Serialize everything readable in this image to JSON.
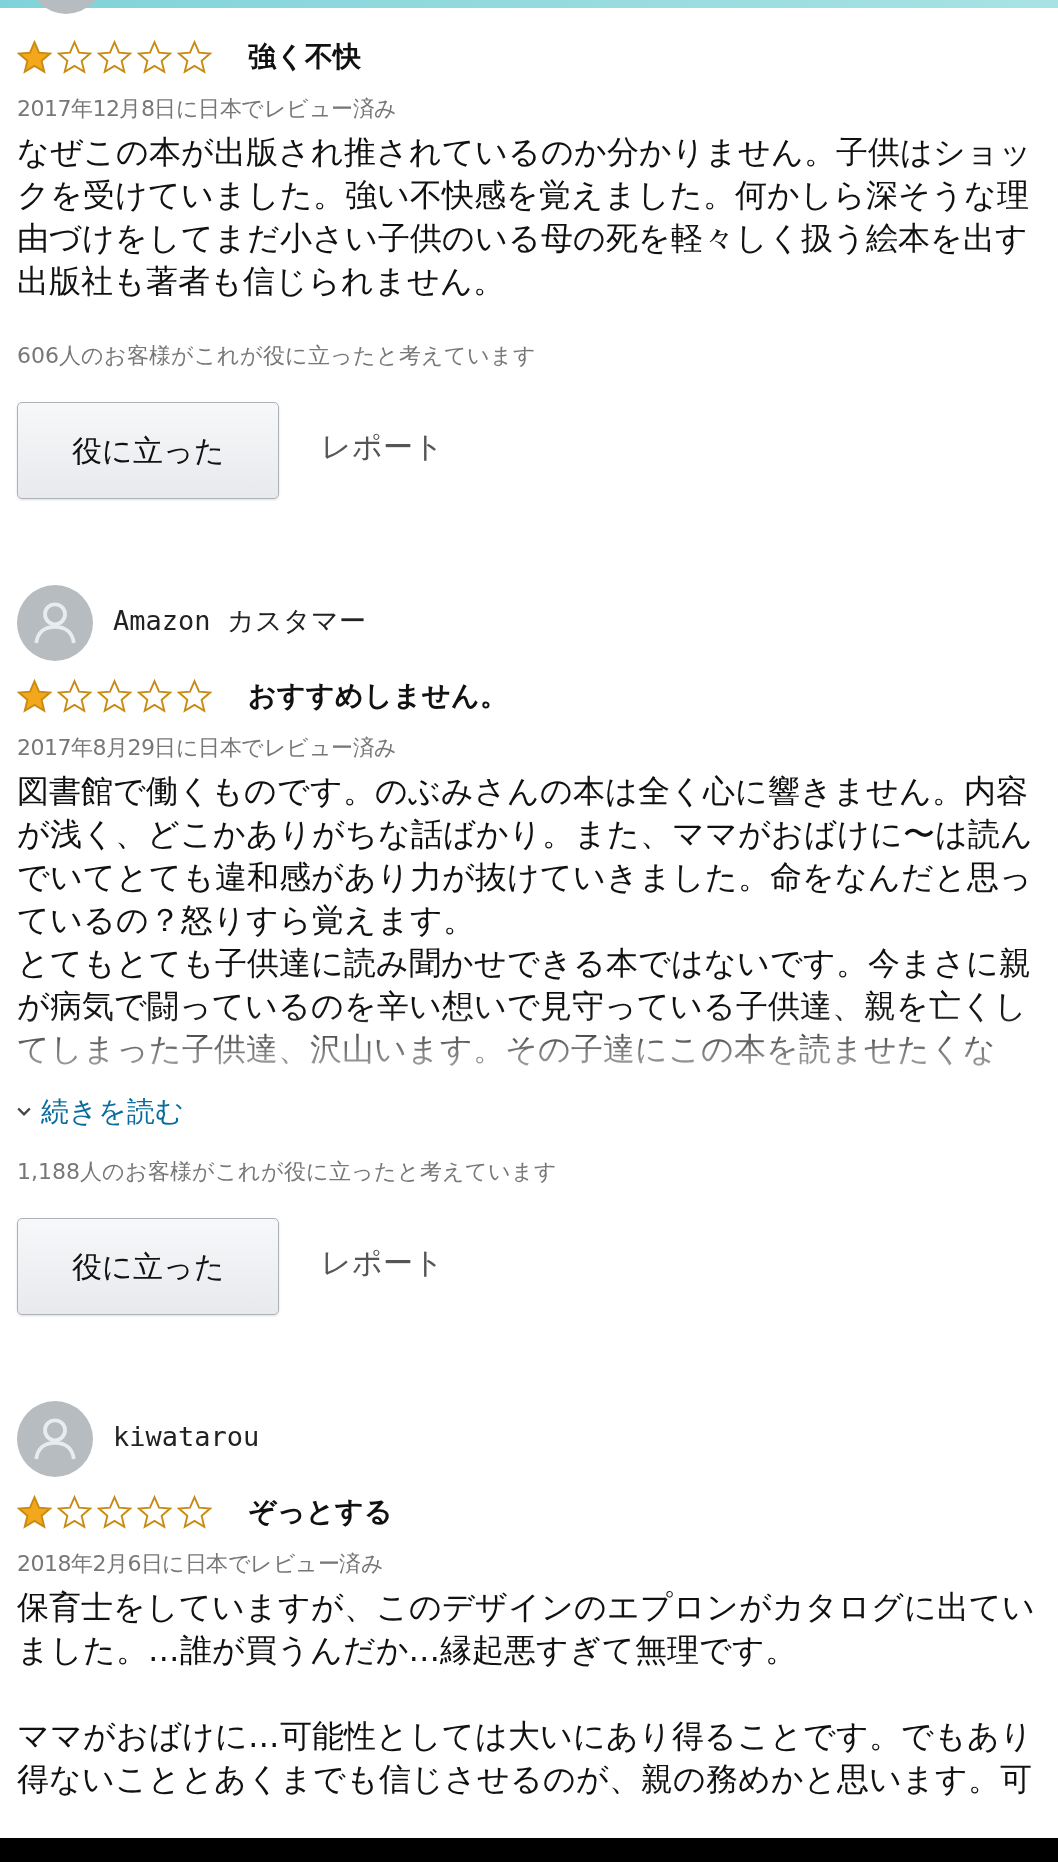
{
  "reviews": [
    {
      "stars": 1,
      "title": "強く不快",
      "date": "2017年12月8日に日本でレビュー済み",
      "body": [
        "なぜこの本が出版され推されているのか分かりません。子供はショックを受けていました。強い不快感を覚えました。何かしら深そうな理由づけをしてまだ小さい子供のいる母の死を軽々しく扱う絵本を出す出版社も著者も信じられません。"
      ],
      "truncated": false,
      "helpful_count": "606人のお客様がこれが役に立ったと考えています",
      "helpful_button": "役に立った",
      "report": "レポート"
    },
    {
      "author": "Amazon カスタマー",
      "stars": 1,
      "title": "おすすめしません。",
      "date": "2017年8月29日に日本でレビュー済み",
      "body": [
        "図書館で働くものです。のぶみさんの本は全く心に響きません。内容が浅く、どこかありがちな話ばかり。また、ママがおばけに〜は読んでいてとても違和感があり力が抜けていきました。命をなんだと思っているの？怒りすら覚えます。",
        "とてもとても子供達に読み聞かせできる本ではないです。今まさに親が病気で闘っているのを辛い想いで見守っている子供達、親を亡くしてしまった子供達、沢山います。その子達にこの本を読ませたくな"
      ],
      "truncated": true,
      "read_more": "続きを読む",
      "helpful_count": "1,188人のお客様がこれが役に立ったと考えています",
      "helpful_button": "役に立った",
      "report": "レポート"
    },
    {
      "author": "kiwatarou",
      "stars": 1,
      "title": "ぞっとする",
      "date": "2018年2月6日に日本でレビュー済み",
      "paragraph_gap": true,
      "body": [
        "保育士をしていますが、このデザインのエプロンがカタログに出ていました。…誰が買うんだか…縁起悪すぎて無理です。",
        "ママがおばけに…可能性としては大いにあり得ることです。でもあり得ないこととあくまでも信じさせるのが、親の務めかと思います。可"
      ],
      "truncated": false
    }
  ]
}
